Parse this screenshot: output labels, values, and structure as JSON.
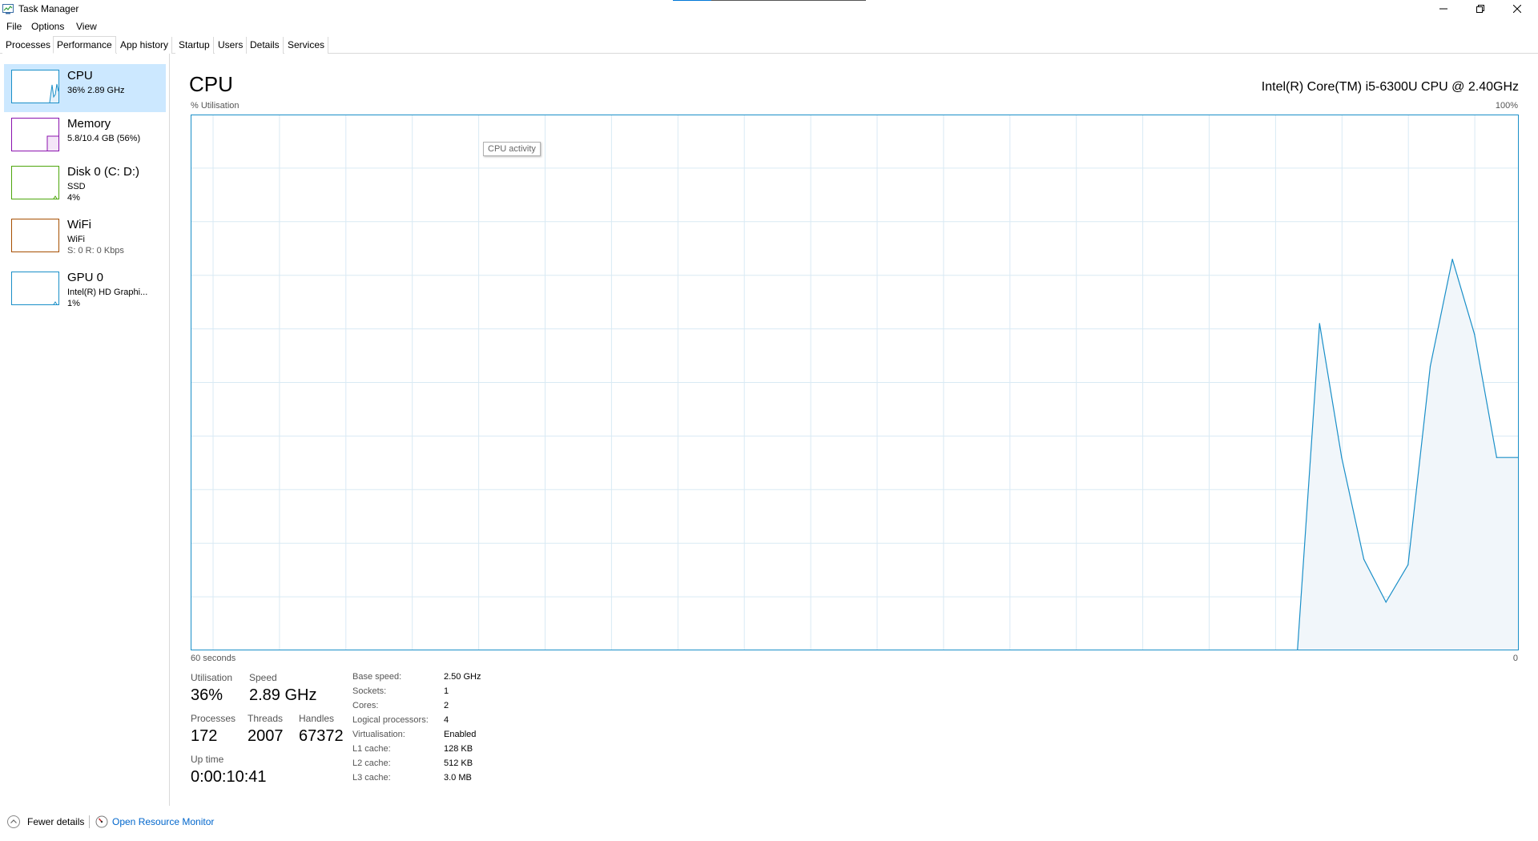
{
  "window": {
    "title": "Task Manager"
  },
  "menu": [
    "File",
    "Options",
    "View"
  ],
  "tabs": [
    "Processes",
    "Performance",
    "App history",
    "Startup",
    "Users",
    "Details",
    "Services"
  ],
  "sidebar": {
    "items": [
      {
        "title": "CPU",
        "line1": "36%  2.89 GHz",
        "line2": "",
        "color": "#1a8fc8"
      },
      {
        "title": "Memory",
        "line1": "5.8/10.4 GB (56%)",
        "line2": "",
        "color": "#8b12ae"
      },
      {
        "title": "Disk 0 (C: D:)",
        "line1": "SSD",
        "line2": "4%",
        "color": "#4da60c"
      },
      {
        "title": "WiFi",
        "line1": "WiFi",
        "line2": "S: 0  R: 0 Kbps",
        "color": "#a74f01"
      },
      {
        "title": "GPU 0",
        "line1": "Intel(R) HD Graphi...",
        "line2": "1%",
        "color": "#1a8fc8"
      }
    ]
  },
  "main": {
    "title": "CPU",
    "cpu_name": "Intel(R) Core(TM) i5-6300U CPU @ 2.40GHz",
    "y_label": "% Utilisation",
    "y_max": "100%",
    "x_left": "60 seconds",
    "x_right": "0",
    "tooltip": "CPU activity"
  },
  "chart_data": {
    "type": "area",
    "xlim": [
      60,
      0
    ],
    "ylim": [
      0,
      100
    ],
    "grid": true,
    "x": [
      60,
      10,
      9,
      8,
      7,
      6,
      5,
      4,
      3,
      2,
      1,
      0
    ],
    "values": [
      0,
      0,
      61,
      36,
      17,
      9,
      16,
      53,
      73,
      59,
      36,
      36
    ]
  },
  "stats": {
    "utilisation_label": "Utilisation",
    "utilisation": "36%",
    "speed_label": "Speed",
    "speed": "2.89 GHz",
    "processes_label": "Processes",
    "processes": "172",
    "threads_label": "Threads",
    "threads": "2007",
    "handles_label": "Handles",
    "handles": "67372",
    "uptime_label": "Up time",
    "uptime": "0:00:10:41"
  },
  "details": [
    {
      "label": "Base speed:",
      "value": "2.50 GHz"
    },
    {
      "label": "Sockets:",
      "value": "1"
    },
    {
      "label": "Cores:",
      "value": "2"
    },
    {
      "label": "Logical processors:",
      "value": "4"
    },
    {
      "label": "Virtualisation:",
      "value": "Enabled"
    },
    {
      "label": "L1 cache:",
      "value": "128 KB"
    },
    {
      "label": "L2 cache:",
      "value": "512 KB"
    },
    {
      "label": "L3 cache:",
      "value": "3.0 MB"
    }
  ],
  "footer": {
    "fewer": "Fewer details",
    "resource_monitor": "Open Resource Monitor"
  },
  "colors": {
    "cpu_line": "#1a8fc8",
    "cpu_fill": "#f1f6fa",
    "grid": "#d9eaf4",
    "link": "#0066cc",
    "selected": "#cce8ff"
  }
}
